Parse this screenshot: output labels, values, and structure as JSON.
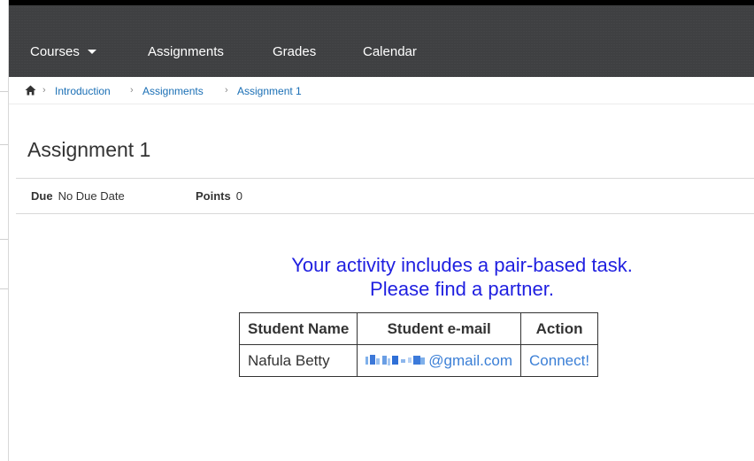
{
  "nav": {
    "courses": "Courses",
    "assignments": "Assignments",
    "grades": "Grades",
    "calendar": "Calendar"
  },
  "breadcrumb": {
    "items": [
      "Introduction",
      "Assignments",
      "Assignment 1"
    ]
  },
  "assignment": {
    "title": "Assignment 1",
    "due_label": "Due",
    "due_value": "No Due Date",
    "points_label": "Points",
    "points_value": "0"
  },
  "notice": {
    "line1": "Your activity includes a pair-based task.",
    "line2": "Please find a partner."
  },
  "table": {
    "headers": [
      "Student Name",
      "Student e-mail",
      "Action"
    ],
    "rows": [
      {
        "name": "Nafula Betty",
        "email_domain": "@gmail.com",
        "action": "Connect!"
      }
    ]
  },
  "colors": {
    "nav_bg": "#3f4042",
    "link": "#1a6fb5",
    "notice": "#1f1fe0",
    "email": "#3b7fd6"
  }
}
